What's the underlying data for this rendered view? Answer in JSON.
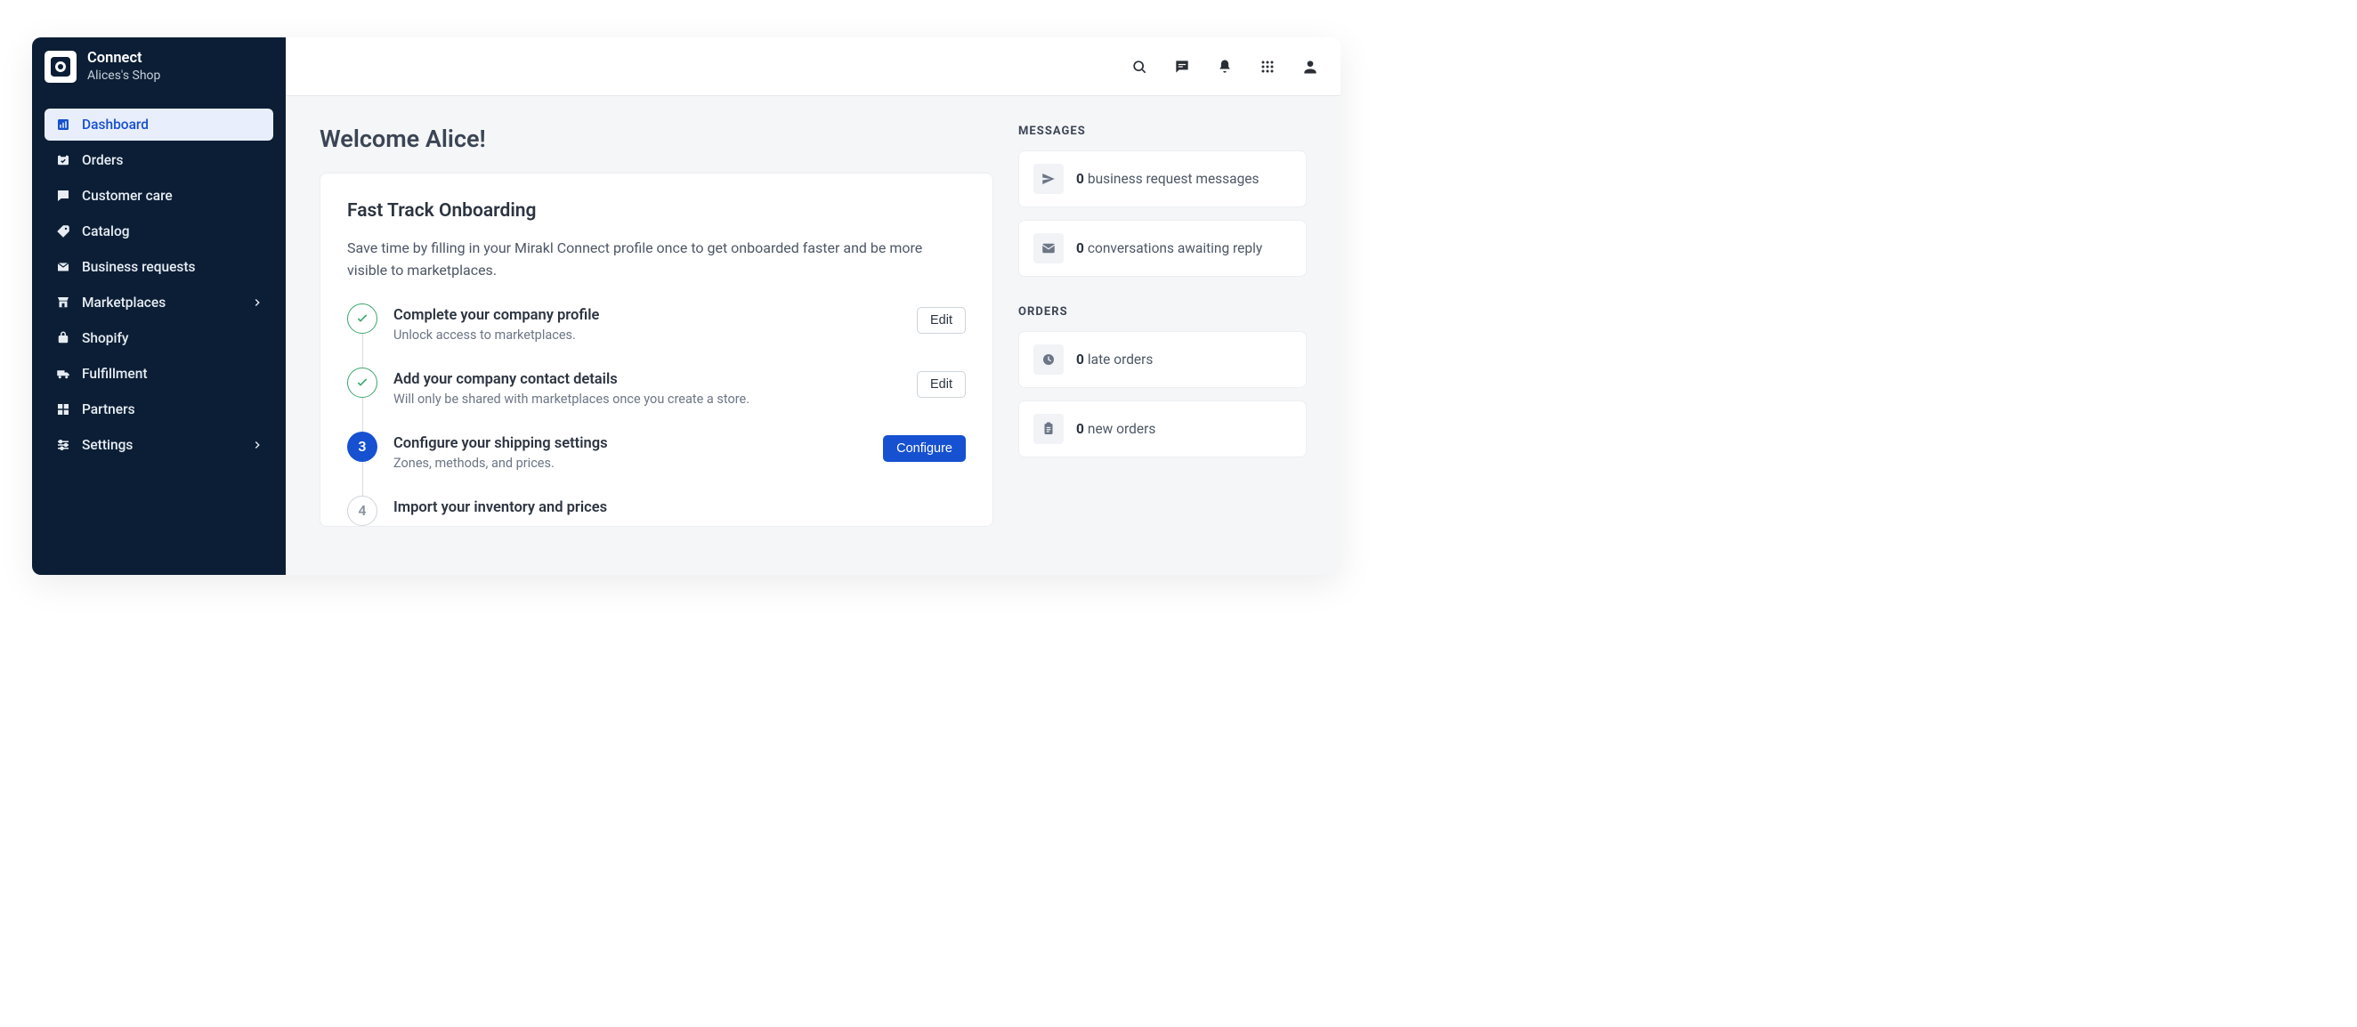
{
  "brand": {
    "title": "Connect",
    "sub": "Alices's Shop"
  },
  "nav": {
    "items": [
      {
        "label": "Dashboard"
      },
      {
        "label": "Orders"
      },
      {
        "label": "Customer care"
      },
      {
        "label": "Catalog"
      },
      {
        "label": "Business requests"
      },
      {
        "label": "Marketplaces"
      },
      {
        "label": "Shopify"
      },
      {
        "label": "Fulfillment"
      },
      {
        "label": "Partners"
      },
      {
        "label": "Settings"
      }
    ]
  },
  "welcome": "Welcome Alice!",
  "onboarding": {
    "title": "Fast Track Onboarding",
    "subtitle": "Save time by filling in your Mirakl Connect profile once to get onboarded faster and be more visible to marketplaces.",
    "steps": [
      {
        "title": "Complete your company profile",
        "desc": "Unlock access to marketplaces.",
        "action": "Edit"
      },
      {
        "title": "Add your company contact details",
        "desc": "Will only be shared with marketplaces once you create a store.",
        "action": "Edit"
      },
      {
        "title": "Configure your shipping settings",
        "desc": "Zones, methods, and prices.",
        "action": "Configure",
        "num": "3"
      },
      {
        "title": "Import your inventory and prices",
        "desc": "",
        "action": "",
        "num": "4"
      }
    ]
  },
  "right": {
    "messages_label": "MESSAGES",
    "orders_label": "ORDERS",
    "stats": {
      "biz_req": {
        "count": "0",
        "label": "business request messages"
      },
      "convo": {
        "count": "0",
        "label": "conversations awaiting reply"
      },
      "late": {
        "count": "0",
        "label": "late orders"
      },
      "neworders": {
        "count": "0",
        "label": "new orders"
      }
    }
  }
}
